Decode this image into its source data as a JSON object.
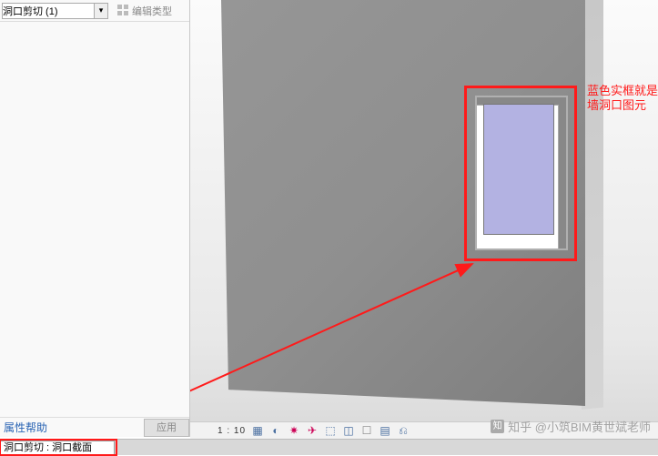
{
  "panel": {
    "type_selector_value": "洞口剪切 (1)",
    "edit_type_label": "编辑类型",
    "help_link": "属性帮助",
    "apply_button": "应用"
  },
  "viewport": {
    "annotation_text": "蓝色实框就是墙洞口图元",
    "colors": {
      "annotation": "#ff1a1a",
      "glass": "#b3b2e2",
      "wall": "#8f8f8f"
    }
  },
  "view_toolbar": {
    "scale": "1 : 10",
    "icons": [
      "view-mode",
      "shade",
      "shadow",
      "path",
      "crop",
      "show-hidden",
      "render",
      "detail",
      "filter"
    ]
  },
  "statusbar": {
    "message": "洞口剪切 : 洞口截面"
  },
  "watermark": {
    "brand": "知",
    "text": "知乎 @小筑BIM黄世斌老师"
  }
}
